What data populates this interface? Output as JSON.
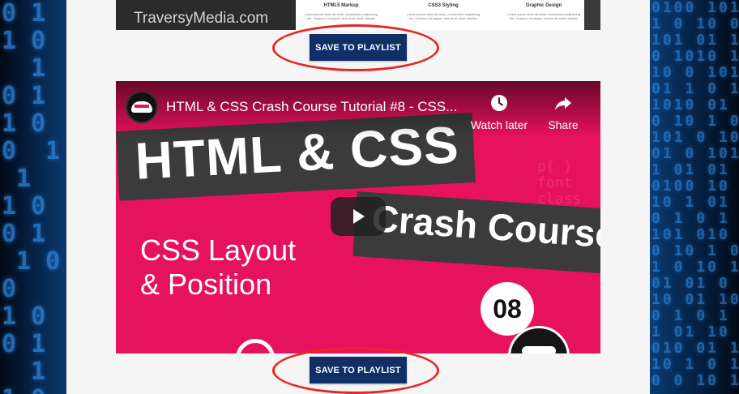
{
  "background": {
    "left_digits": "0 1\n1 0\n  1\n0 1\n1 0\n0  1\n 1\n1 0\n0 1\n 1 0\n0\n1 0\n0 1\n  1\n1 0",
    "right_digits": "0100 101\n1 0 10 0\n101 01 1\n0 1010 1\n10 0 101\n01 1 0 1\n1010 01\n0 10 1 0\n101 0 10\n01 0 101\n1 01 01\n0100 10\n10 1 01\n0 1 0 1\n101 010\n0 10 1 0\n1 0 10 1\n01 01 0\n10 01 10\n0 1 0 1\n1 01 10\n010 01 1\n10 1 0 1\n0 0 10 1",
    "color_accent": "#2f86d9"
  },
  "top_video": {
    "brand": "TraversyMedia.com",
    "columns": [
      {
        "heading": "HTML5 Markup",
        "text": "Lorem ipsum dolor sit amet, consectetur adipiscing elit. Vivamus mi augue, viverra sit amet ultricies"
      },
      {
        "heading": "CSS3 Styling",
        "text": "Lorem ipsum dolor sit amet, consectetur adipiscing elit. Vivamus mi augue, viverra sit amet ultricies"
      },
      {
        "heading": "Graphic Design",
        "text": "Lorem ipsum dolor sit amet, consectetur adipiscing elit. Vivamus mi augue, viverra sit amet ultricies"
      }
    ]
  },
  "buttons": {
    "save1": "SAVE TO PLAYLIST",
    "save2": "SAVE TO PLAYLIST"
  },
  "highlight_color": "#e62824",
  "main_video": {
    "title": "HTML & CSS Crash Course Tutorial #8 - CSS...",
    "watch_later": "Watch later",
    "share": "Share",
    "thumb_title": "HTML & CSS",
    "thumb_banner": "Crash Course",
    "thumb_subtitle": "CSS Layout\n& Position",
    "thumb_number": "08",
    "thumb_bg": "#e7125e",
    "ghost_code": "p{ }\nfont\nclass\ndiv{\n  flex\n}"
  }
}
